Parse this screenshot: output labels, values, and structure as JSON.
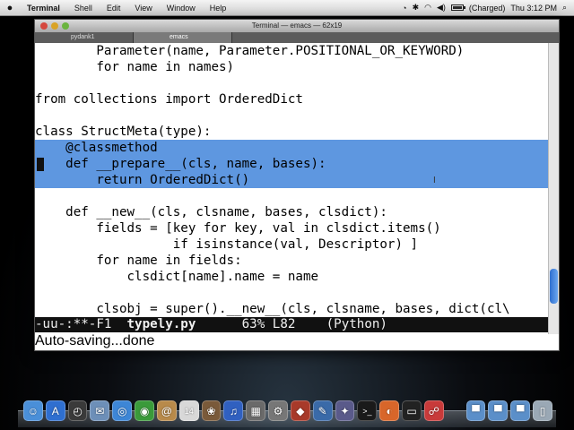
{
  "menubar": {
    "app_name": "Terminal",
    "items": [
      "Shell",
      "Edit",
      "View",
      "Window",
      "Help"
    ],
    "battery_label": "(Charged)",
    "battery_level": 1.0,
    "clock": "Thu 3:12 PM"
  },
  "window": {
    "title": "Terminal — emacs — 62x19",
    "tabs": [
      "pydank1",
      "emacs"
    ]
  },
  "editor": {
    "highlight_color": "#5e97e0",
    "lines": [
      "        Parameter(name, Parameter.POSITIONAL_OR_KEYWORD)",
      "        for name in names)",
      "",
      "from collections import OrderedDict",
      "",
      "class StructMeta(type):",
      "    @classmethod",
      "    def __prepare__(cls, name, bases):",
      "        return OrderedDict()",
      "",
      "    def __new__(cls, clsname, bases, clsdict):",
      "        fields = [key for key, val in clsdict.items()",
      "                  if isinstance(val, Descriptor) ]",
      "        for name in fields:",
      "            clsdict[name].name = name",
      "",
      "        clsobj = super().__new__(cls, clsname, bases, dict(cl\\"
    ],
    "highlighted_lines": [
      6,
      7,
      8
    ],
    "modeline": {
      "status": "-uu-:**-F1",
      "buffer": "typely.py",
      "position": "63% L82",
      "mode": "(Python)"
    },
    "minibuffer": "Auto-saving...done"
  },
  "scrollbar": {
    "position_fraction": 0.88,
    "visible_fraction": 0.12
  },
  "dock": {
    "items": [
      {
        "name": "finder-icon",
        "color": "#4a8fd8",
        "glyph": "☺"
      },
      {
        "name": "app-store-icon",
        "color": "#2f6fd0",
        "glyph": "A"
      },
      {
        "name": "dashboard-icon",
        "color": "#3a3a3a",
        "glyph": "◴"
      },
      {
        "name": "mail-icon",
        "color": "#6d8fb8",
        "glyph": "✉"
      },
      {
        "name": "safari-icon",
        "color": "#3d86d6",
        "glyph": "◎"
      },
      {
        "name": "facetime-icon",
        "color": "#3a9a3a",
        "glyph": "◉"
      },
      {
        "name": "address-book-icon",
        "color": "#b88a4a",
        "glyph": "@"
      },
      {
        "name": "calendar-icon",
        "color": "#d8d8d8",
        "glyph": "14"
      },
      {
        "name": "photos-icon",
        "color": "#7a5a3a",
        "glyph": "❀"
      },
      {
        "name": "itunes-icon",
        "color": "#3060c0",
        "glyph": "♫"
      },
      {
        "name": "preview-icon",
        "color": "#6a6a6a",
        "glyph": "▦"
      },
      {
        "name": "system-preferences-icon",
        "color": "#777777",
        "glyph": "⚙"
      },
      {
        "name": "messages-icon",
        "color": "#a83a2a",
        "glyph": "◆"
      },
      {
        "name": "xcode-icon",
        "color": "#3a6aa8",
        "glyph": "✎"
      },
      {
        "name": "utilities-icon",
        "color": "#5a5a8a",
        "glyph": "✦"
      },
      {
        "name": "terminal-icon",
        "color": "#1a1a1a",
        "glyph": ">_"
      },
      {
        "name": "firefox-icon",
        "color": "#d8662a",
        "glyph": "◐"
      },
      {
        "name": "console-icon",
        "color": "#222222",
        "glyph": "▭"
      },
      {
        "name": "network-icon",
        "color": "#c83a3a",
        "glyph": "☍"
      }
    ],
    "folders": [
      {
        "name": "applications-folder-icon",
        "color": "#5b8fc9",
        "glyph": "▀"
      },
      {
        "name": "documents-folder-icon",
        "color": "#5b8fc9",
        "glyph": "▀"
      },
      {
        "name": "downloads-folder-icon",
        "color": "#5b8fc9",
        "glyph": "▀"
      },
      {
        "name": "trash-icon",
        "color": "#9aa8b5",
        "glyph": "▯"
      }
    ]
  }
}
